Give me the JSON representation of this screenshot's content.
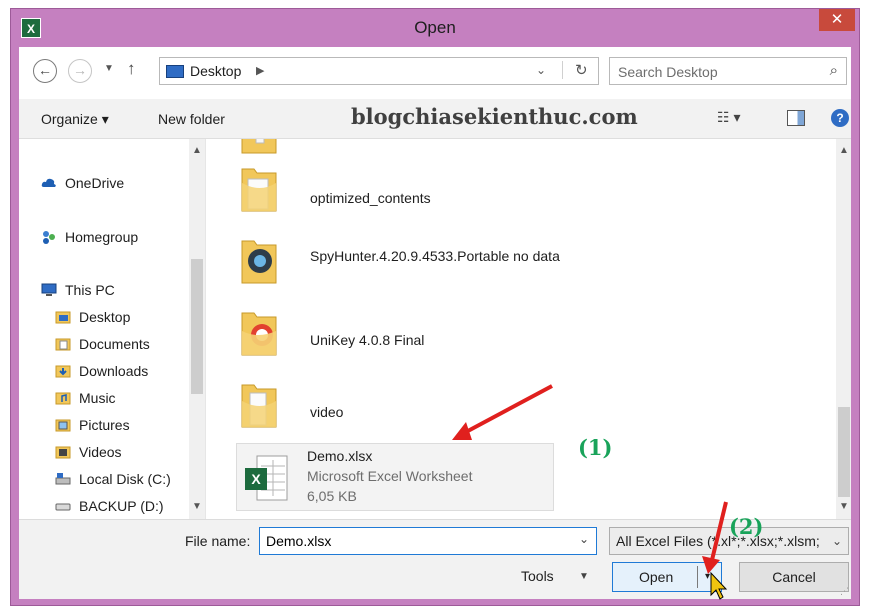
{
  "window": {
    "title": "Open",
    "app_icon": "X",
    "close_glyph": "✕"
  },
  "nav": {
    "back_glyph": "←",
    "forward_glyph": "→",
    "recent_glyph": "▼",
    "up_glyph": "↑",
    "address": "Desktop",
    "address_sep": "▶",
    "address_drop": "⌄",
    "refresh_glyph": "↻"
  },
  "search": {
    "placeholder": "Search Desktop",
    "icon": "⌕"
  },
  "toolbar": {
    "organize": "Organize ▾",
    "new_folder": "New folder",
    "watermark": "blogchiasekienthuc.com",
    "view_glyph": "☷ ▾",
    "help_glyph": "?"
  },
  "sidebar": {
    "scroll_up": "▲",
    "scroll_down": "▼",
    "items": [
      {
        "label": "OneDrive",
        "icon": "cloud-icon"
      },
      {
        "label": "Homegroup",
        "icon": "homegroup-icon"
      },
      {
        "label": "This PC",
        "icon": "computer-icon"
      },
      {
        "label": "Desktop",
        "icon": "desktop-folder-icon"
      },
      {
        "label": "Documents",
        "icon": "documents-icon"
      },
      {
        "label": "Downloads",
        "icon": "downloads-icon"
      },
      {
        "label": "Music",
        "icon": "music-icon"
      },
      {
        "label": "Pictures",
        "icon": "pictures-icon"
      },
      {
        "label": "Videos",
        "icon": "videos-icon"
      },
      {
        "label": "Local Disk (C:)",
        "icon": "drive-icon"
      },
      {
        "label": "BACKUP (D:)",
        "icon": "drive-icon"
      }
    ]
  },
  "files": {
    "items": [
      {
        "name": "optimized_contents",
        "icon": "folder-icon"
      },
      {
        "name": "SpyHunter.4.20.9.4533.Portable no data",
        "icon": "folder-spyhunter-icon"
      },
      {
        "name": "UniKey 4.0.8 Final",
        "icon": "folder-unikey-icon"
      },
      {
        "name": "video",
        "icon": "folder-icon"
      }
    ],
    "selected": {
      "name": "Demo.xlsx",
      "type": "Microsoft Excel Worksheet",
      "size": "6,05 KB",
      "icon": "excel-file-icon"
    }
  },
  "bottom": {
    "file_name_label": "File name:",
    "file_name_value": "Demo.xlsx",
    "filter": "All Excel Files (*.xl*;*.xlsx;*.xlsm;",
    "drop_glyph": "⌄",
    "tools": "Tools",
    "tools_drop": "▼",
    "open": "Open",
    "open_drop": "▾",
    "cancel": "Cancel",
    "grip": "⋰"
  },
  "annotations": {
    "step1": "(1)",
    "step2": "(2)"
  },
  "colors": {
    "titlebar": "#c580c0",
    "close": "#c84a3c",
    "accent": "#1f7ad6",
    "annotation": "#19a35a",
    "arrow": "#e0201e"
  }
}
